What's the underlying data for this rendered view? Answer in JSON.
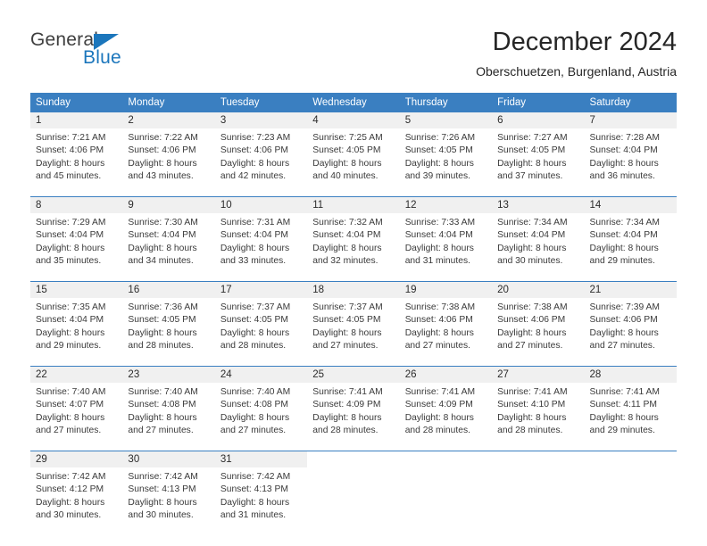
{
  "brand": {
    "name_part1": "General",
    "name_part2": "Blue",
    "accent_color": "#1b76bc"
  },
  "header": {
    "title": "December 2024",
    "location": "Oberschuetzen, Burgenland, Austria"
  },
  "calendar": {
    "header_color": "#3a7fc1",
    "weekdays": [
      "Sunday",
      "Monday",
      "Tuesday",
      "Wednesday",
      "Thursday",
      "Friday",
      "Saturday"
    ],
    "weeks": [
      [
        {
          "day": "1",
          "sunrise": "Sunrise: 7:21 AM",
          "sunset": "Sunset: 4:06 PM",
          "daylight_line1": "Daylight: 8 hours",
          "daylight_line2": "and 45 minutes."
        },
        {
          "day": "2",
          "sunrise": "Sunrise: 7:22 AM",
          "sunset": "Sunset: 4:06 PM",
          "daylight_line1": "Daylight: 8 hours",
          "daylight_line2": "and 43 minutes."
        },
        {
          "day": "3",
          "sunrise": "Sunrise: 7:23 AM",
          "sunset": "Sunset: 4:06 PM",
          "daylight_line1": "Daylight: 8 hours",
          "daylight_line2": "and 42 minutes."
        },
        {
          "day": "4",
          "sunrise": "Sunrise: 7:25 AM",
          "sunset": "Sunset: 4:05 PM",
          "daylight_line1": "Daylight: 8 hours",
          "daylight_line2": "and 40 minutes."
        },
        {
          "day": "5",
          "sunrise": "Sunrise: 7:26 AM",
          "sunset": "Sunset: 4:05 PM",
          "daylight_line1": "Daylight: 8 hours",
          "daylight_line2": "and 39 minutes."
        },
        {
          "day": "6",
          "sunrise": "Sunrise: 7:27 AM",
          "sunset": "Sunset: 4:05 PM",
          "daylight_line1": "Daylight: 8 hours",
          "daylight_line2": "and 37 minutes."
        },
        {
          "day": "7",
          "sunrise": "Sunrise: 7:28 AM",
          "sunset": "Sunset: 4:04 PM",
          "daylight_line1": "Daylight: 8 hours",
          "daylight_line2": "and 36 minutes."
        }
      ],
      [
        {
          "day": "8",
          "sunrise": "Sunrise: 7:29 AM",
          "sunset": "Sunset: 4:04 PM",
          "daylight_line1": "Daylight: 8 hours",
          "daylight_line2": "and 35 minutes."
        },
        {
          "day": "9",
          "sunrise": "Sunrise: 7:30 AM",
          "sunset": "Sunset: 4:04 PM",
          "daylight_line1": "Daylight: 8 hours",
          "daylight_line2": "and 34 minutes."
        },
        {
          "day": "10",
          "sunrise": "Sunrise: 7:31 AM",
          "sunset": "Sunset: 4:04 PM",
          "daylight_line1": "Daylight: 8 hours",
          "daylight_line2": "and 33 minutes."
        },
        {
          "day": "11",
          "sunrise": "Sunrise: 7:32 AM",
          "sunset": "Sunset: 4:04 PM",
          "daylight_line1": "Daylight: 8 hours",
          "daylight_line2": "and 32 minutes."
        },
        {
          "day": "12",
          "sunrise": "Sunrise: 7:33 AM",
          "sunset": "Sunset: 4:04 PM",
          "daylight_line1": "Daylight: 8 hours",
          "daylight_line2": "and 31 minutes."
        },
        {
          "day": "13",
          "sunrise": "Sunrise: 7:34 AM",
          "sunset": "Sunset: 4:04 PM",
          "daylight_line1": "Daylight: 8 hours",
          "daylight_line2": "and 30 minutes."
        },
        {
          "day": "14",
          "sunrise": "Sunrise: 7:34 AM",
          "sunset": "Sunset: 4:04 PM",
          "daylight_line1": "Daylight: 8 hours",
          "daylight_line2": "and 29 minutes."
        }
      ],
      [
        {
          "day": "15",
          "sunrise": "Sunrise: 7:35 AM",
          "sunset": "Sunset: 4:04 PM",
          "daylight_line1": "Daylight: 8 hours",
          "daylight_line2": "and 29 minutes."
        },
        {
          "day": "16",
          "sunrise": "Sunrise: 7:36 AM",
          "sunset": "Sunset: 4:05 PM",
          "daylight_line1": "Daylight: 8 hours",
          "daylight_line2": "and 28 minutes."
        },
        {
          "day": "17",
          "sunrise": "Sunrise: 7:37 AM",
          "sunset": "Sunset: 4:05 PM",
          "daylight_line1": "Daylight: 8 hours",
          "daylight_line2": "and 28 minutes."
        },
        {
          "day": "18",
          "sunrise": "Sunrise: 7:37 AM",
          "sunset": "Sunset: 4:05 PM",
          "daylight_line1": "Daylight: 8 hours",
          "daylight_line2": "and 27 minutes."
        },
        {
          "day": "19",
          "sunrise": "Sunrise: 7:38 AM",
          "sunset": "Sunset: 4:06 PM",
          "daylight_line1": "Daylight: 8 hours",
          "daylight_line2": "and 27 minutes."
        },
        {
          "day": "20",
          "sunrise": "Sunrise: 7:38 AM",
          "sunset": "Sunset: 4:06 PM",
          "daylight_line1": "Daylight: 8 hours",
          "daylight_line2": "and 27 minutes."
        },
        {
          "day": "21",
          "sunrise": "Sunrise: 7:39 AM",
          "sunset": "Sunset: 4:06 PM",
          "daylight_line1": "Daylight: 8 hours",
          "daylight_line2": "and 27 minutes."
        }
      ],
      [
        {
          "day": "22",
          "sunrise": "Sunrise: 7:40 AM",
          "sunset": "Sunset: 4:07 PM",
          "daylight_line1": "Daylight: 8 hours",
          "daylight_line2": "and 27 minutes."
        },
        {
          "day": "23",
          "sunrise": "Sunrise: 7:40 AM",
          "sunset": "Sunset: 4:08 PM",
          "daylight_line1": "Daylight: 8 hours",
          "daylight_line2": "and 27 minutes."
        },
        {
          "day": "24",
          "sunrise": "Sunrise: 7:40 AM",
          "sunset": "Sunset: 4:08 PM",
          "daylight_line1": "Daylight: 8 hours",
          "daylight_line2": "and 27 minutes."
        },
        {
          "day": "25",
          "sunrise": "Sunrise: 7:41 AM",
          "sunset": "Sunset: 4:09 PM",
          "daylight_line1": "Daylight: 8 hours",
          "daylight_line2": "and 28 minutes."
        },
        {
          "day": "26",
          "sunrise": "Sunrise: 7:41 AM",
          "sunset": "Sunset: 4:09 PM",
          "daylight_line1": "Daylight: 8 hours",
          "daylight_line2": "and 28 minutes."
        },
        {
          "day": "27",
          "sunrise": "Sunrise: 7:41 AM",
          "sunset": "Sunset: 4:10 PM",
          "daylight_line1": "Daylight: 8 hours",
          "daylight_line2": "and 28 minutes."
        },
        {
          "day": "28",
          "sunrise": "Sunrise: 7:41 AM",
          "sunset": "Sunset: 4:11 PM",
          "daylight_line1": "Daylight: 8 hours",
          "daylight_line2": "and 29 minutes."
        }
      ],
      [
        {
          "day": "29",
          "sunrise": "Sunrise: 7:42 AM",
          "sunset": "Sunset: 4:12 PM",
          "daylight_line1": "Daylight: 8 hours",
          "daylight_line2": "and 30 minutes."
        },
        {
          "day": "30",
          "sunrise": "Sunrise: 7:42 AM",
          "sunset": "Sunset: 4:13 PM",
          "daylight_line1": "Daylight: 8 hours",
          "daylight_line2": "and 30 minutes."
        },
        {
          "day": "31",
          "sunrise": "Sunrise: 7:42 AM",
          "sunset": "Sunset: 4:13 PM",
          "daylight_line1": "Daylight: 8 hours",
          "daylight_line2": "and 31 minutes."
        },
        {
          "day": "",
          "sunrise": "",
          "sunset": "",
          "daylight_line1": "",
          "daylight_line2": ""
        },
        {
          "day": "",
          "sunrise": "",
          "sunset": "",
          "daylight_line1": "",
          "daylight_line2": ""
        },
        {
          "day": "",
          "sunrise": "",
          "sunset": "",
          "daylight_line1": "",
          "daylight_line2": ""
        },
        {
          "day": "",
          "sunrise": "",
          "sunset": "",
          "daylight_line1": "",
          "daylight_line2": ""
        }
      ]
    ]
  }
}
